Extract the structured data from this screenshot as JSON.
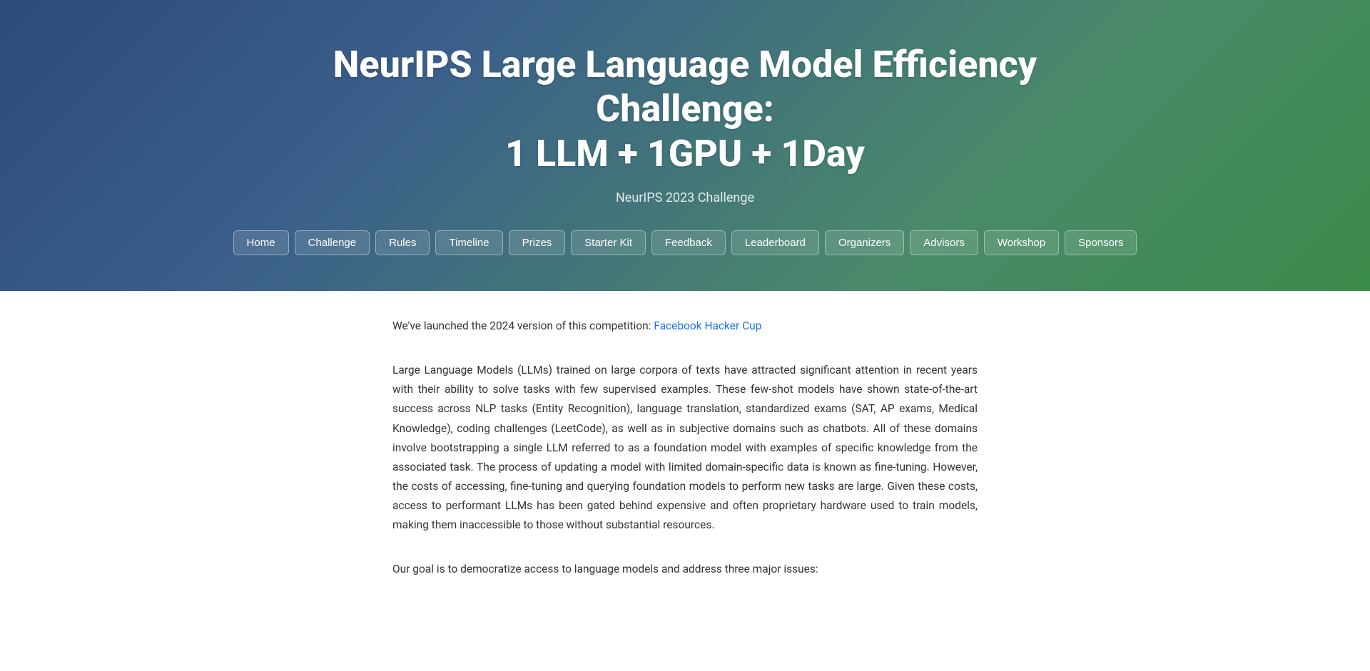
{
  "hero": {
    "title": "NeurIPS Large Language Model Efficiency Challenge:",
    "title_line2": "1 LLM + 1GPU + 1Day",
    "subtitle": "NeurIPS 2023 Challenge"
  },
  "nav": {
    "items": [
      {
        "label": "Home",
        "id": "home"
      },
      {
        "label": "Challenge",
        "id": "challenge"
      },
      {
        "label": "Rules",
        "id": "rules"
      },
      {
        "label": "Timeline",
        "id": "timeline"
      },
      {
        "label": "Prizes",
        "id": "prizes"
      },
      {
        "label": "Starter Kit",
        "id": "starter-kit"
      },
      {
        "label": "Feedback",
        "id": "feedback"
      },
      {
        "label": "Leaderboard",
        "id": "leaderboard"
      },
      {
        "label": "Organizers",
        "id": "organizers"
      },
      {
        "label": "Advisors",
        "id": "advisors"
      },
      {
        "label": "Workshop",
        "id": "workshop"
      },
      {
        "label": "Sponsors",
        "id": "sponsors"
      }
    ]
  },
  "content": {
    "launch_notice_prefix": "We've launched the 2024 version of this competition:",
    "launch_notice_link_text": "Facebook Hacker Cup",
    "launch_notice_link_href": "#",
    "body_paragraph": "Large Language Models (LLMs) trained on large corpora of texts have attracted significant attention in recent years with their ability to solve tasks with few supervised examples. These few-shot models have shown state-of-the-art success across NLP tasks (Entity Recognition), language translation, standardized exams (SAT, AP exams, Medical Knowledge), coding challenges (LeetCode), as well as in subjective domains such as chatbots. All of these domains involve bootstrapping a single LLM referred to as a foundation model with examples of specific knowledge from the associated task. The process of updating a model with limited domain-specific data is known as fine-tuning. However, the costs of accessing, fine-tuning and querying foundation models to perform new tasks are large. Given these costs, access to performant LLMs has been gated behind expensive and often proprietary hardware used to train models, making them inaccessible to those without substantial resources.",
    "goal_paragraph": "Our goal is to democratize access to language models and address three major issues:"
  }
}
